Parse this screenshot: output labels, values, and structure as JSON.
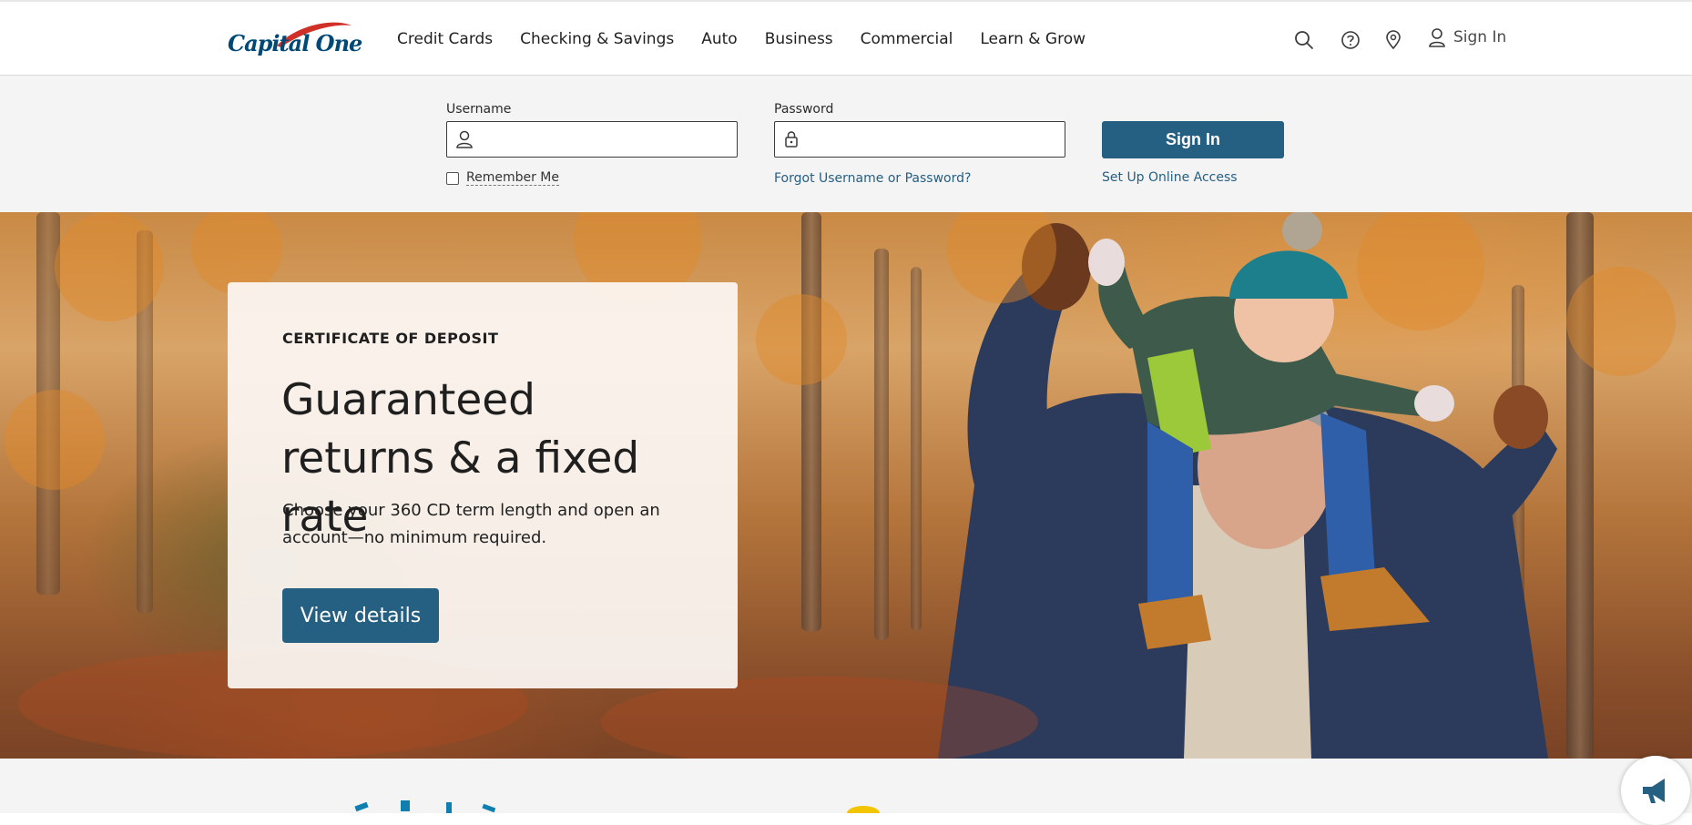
{
  "header": {
    "logo_text": "Capital One",
    "nav": [
      "Credit Cards",
      "Checking & Savings",
      "Auto",
      "Business",
      "Commercial",
      "Learn & Grow"
    ],
    "sign_in_label": "Sign In"
  },
  "signin_form": {
    "username_label": "Username",
    "username_value": "",
    "password_label": "Password",
    "password_value": "",
    "remember_label": "Remember Me",
    "remember_checked": false,
    "forgot_link": "Forgot Username or Password?",
    "submit_label": "Sign In",
    "setup_link": "Set Up Online Access"
  },
  "hero": {
    "eyebrow": "CERTIFICATE OF DEPOSIT",
    "headline": "Guaranteed returns & a fixed rate",
    "subtext": "Choose your 360 CD term length and open an account—no minimum required.",
    "cta_label": "View details"
  },
  "colors": {
    "brand_blue": "#004977",
    "button_blue": "#255f82",
    "logo_red": "#d03027",
    "band_gray": "#f4f4f4"
  },
  "icons": {
    "search": "search-icon",
    "help": "help-icon",
    "location": "location-icon",
    "user": "user-icon",
    "lock": "lock-icon",
    "feedback": "megaphone-icon"
  }
}
